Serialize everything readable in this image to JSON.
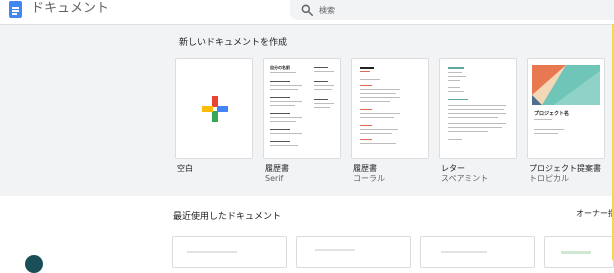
{
  "app": {
    "title": "ドキュメント"
  },
  "search": {
    "placeholder": "検索"
  },
  "templates": {
    "section_title": "新しいドキュメントを作成",
    "items": [
      {
        "name": "空白",
        "subtitle": ""
      },
      {
        "name": "履歴書",
        "subtitle": "Serif"
      },
      {
        "name": "履歴書",
        "subtitle": "コーラル"
      },
      {
        "name": "レター",
        "subtitle": "スペアミント"
      },
      {
        "name": "プロジェクト提案書",
        "subtitle": "トロピカル"
      }
    ],
    "card_texts": {
      "serif_heading": "自分の名前",
      "project_heading": "プロジェクト名"
    }
  },
  "recent": {
    "title": "最近使用したドキュメント",
    "owner_filter": "オーナー指"
  },
  "colors": {
    "accent_blue": "#4285f4",
    "background_gray": "#f1f3f4",
    "plus_red": "#ea4335",
    "plus_blue": "#4285f4",
    "plus_yellow": "#fbbc04",
    "plus_green": "#34a853"
  },
  "icons": [
    "docs-app-icon",
    "search-icon",
    "plus-icon"
  ]
}
